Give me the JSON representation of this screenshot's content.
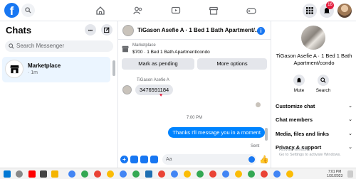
{
  "topnav": {
    "logo_letter": "f",
    "notification_count": "16"
  },
  "sidebar": {
    "title": "Chats",
    "more_icon_glyph": "•••",
    "search_placeholder": "Search Messenger",
    "chats": [
      {
        "name": "Marketplace",
        "time": "· 1m"
      }
    ]
  },
  "conversation": {
    "title": "TiGason Asefie A · 1 Bed 1 Bath Apartment/...",
    "listing": {
      "source": "Marketplace",
      "title": "$700 · 1 Bed 1 Bath Apartment/condo",
      "buttons": [
        "Mark as pending",
        "More options"
      ]
    },
    "sender_name": "TiGason Asefie A",
    "incoming_message": "3476591184",
    "reaction": "♥",
    "time_separator": "7:00 PM",
    "outgoing_message": "Thanks I'll message you in a moment",
    "status": "Sent",
    "composer_placeholder": "Aa"
  },
  "right_panel": {
    "name": "TiGason Asefie A · 1 Bed 1 Bath Apartment/condo",
    "actions": [
      "Mute",
      "Search"
    ],
    "sections": [
      "Customize chat",
      "Chat members",
      "Media, files and links",
      "Privacy & support"
    ],
    "watermark_line1": "Activate Windows",
    "watermark_line2": "Go to Settings to activate Windows."
  },
  "taskbar": {
    "time": "7:01 PM",
    "date": "1/31/2023"
  },
  "colors": {
    "brand": "#1877f2",
    "outgoing_bubble": "#0084ff",
    "badge": "#e41e3f"
  }
}
